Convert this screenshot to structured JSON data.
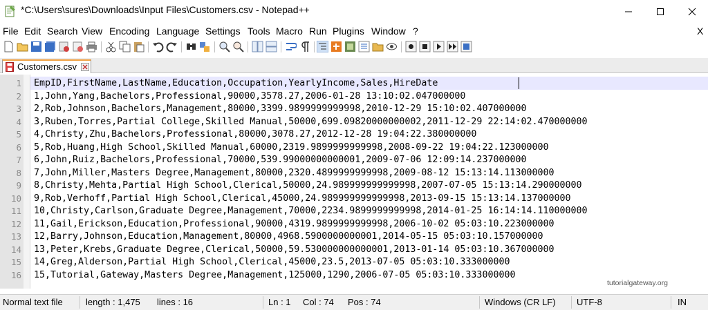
{
  "window": {
    "title": "*C:\\Users\\sures\\Downloads\\Input Files\\Customers.csv - Notepad++"
  },
  "menu": {
    "items": [
      "File",
      "Edit",
      "Search",
      "View",
      "Encoding",
      "Language",
      "Settings",
      "Tools",
      "Macro",
      "Run",
      "Plugins",
      "Window",
      "?"
    ],
    "close_label": "X"
  },
  "toolbar": {
    "icons": [
      "new-file-icon",
      "open-file-icon",
      "save-icon",
      "save-all-icon",
      "close-icon",
      "close-all-icon",
      "print-icon",
      "cut-icon",
      "copy-icon",
      "paste-icon",
      "undo-icon",
      "redo-icon",
      "find-icon",
      "replace-icon",
      "zoom-in-icon",
      "zoom-out-icon",
      "sync-vertical-icon",
      "sync-horizontal-icon",
      "word-wrap-icon",
      "show-all-chars-icon",
      "indent-guide-icon",
      "user-language-icon",
      "doc-map-icon",
      "function-list-icon",
      "folder-workspace-icon",
      "monitoring-icon",
      "record-macro-icon",
      "stop-record-icon",
      "play-macro-icon",
      "run-macro-multiple-icon",
      "save-macro-icon"
    ]
  },
  "tab": {
    "label": "Customers.csv"
  },
  "editor": {
    "line_numbers": [
      "1",
      "2",
      "3",
      "4",
      "5",
      "6",
      "7",
      "8",
      "9",
      "10",
      "11",
      "12",
      "13",
      "14",
      "15",
      "16"
    ],
    "lines": [
      "EmpID,FirstName,LastName,Education,Occupation,YearlyIncome,Sales,HireDate",
      "1,John,Yang,Bachelors,Professional,90000,3578.27,2006-01-28 13:10:02.047000000",
      "2,Rob,Johnson,Bachelors,Management,80000,3399.9899999999998,2010-12-29 15:10:02.407000000",
      "3,Ruben,Torres,Partial College,Skilled Manual,50000,699.09820000000002,2011-12-29 22:14:02.470000000",
      "4,Christy,Zhu,Bachelors,Professional,80000,3078.27,2012-12-28 19:04:22.380000000",
      "5,Rob,Huang,High School,Skilled Manual,60000,2319.9899999999998,2008-09-22 19:04:22.123000000",
      "6,John,Ruiz,Bachelors,Professional,70000,539.99000000000001,2009-07-06 12:09:14.237000000",
      "7,John,Miller,Masters Degree,Management,80000,2320.4899999999998,2009-08-12 15:13:14.113000000",
      "8,Christy,Mehta,Partial High School,Clerical,50000,24.989999999999998,2007-07-05 15:13:14.290000000",
      "9,Rob,Verhoff,Partial High School,Clerical,45000,24.989999999999998,2013-09-15 15:13:14.137000000",
      "10,Christy,Carlson,Graduate Degree,Management,70000,2234.9899999999998,2014-01-25 16:14:14.110000000",
      "11,Gail,Erickson,Education,Professional,90000,4319.9899999999998,2006-10-02 05:03:10.223000000",
      "12,Barry,Johnson,Education,Management,80000,4968.5900000000001,2014-05-15 05:03:10.157000000",
      "13,Peter,Krebs,Graduate Degree,Clerical,50000,59.530000000000001,2013-01-14 05:03:10.367000000",
      "14,Greg,Alderson,Partial High School,Clerical,45000,23.5,2013-07-05 05:03:10.333000000",
      "15,Tutorial,Gateway,Masters Degree,Management,125000,1290,2006-07-05 05:03:10.333000000"
    ],
    "watermark": "tutorialgateway.org"
  },
  "status": {
    "file_type": "Normal text file",
    "length": "length : 1,475",
    "lines": "lines : 16",
    "ln": "Ln : 1",
    "col": "Col : 74",
    "pos": "Pos : 74",
    "eol": "Windows (CR LF)",
    "encoding": "UTF-8",
    "mode": "IN"
  }
}
